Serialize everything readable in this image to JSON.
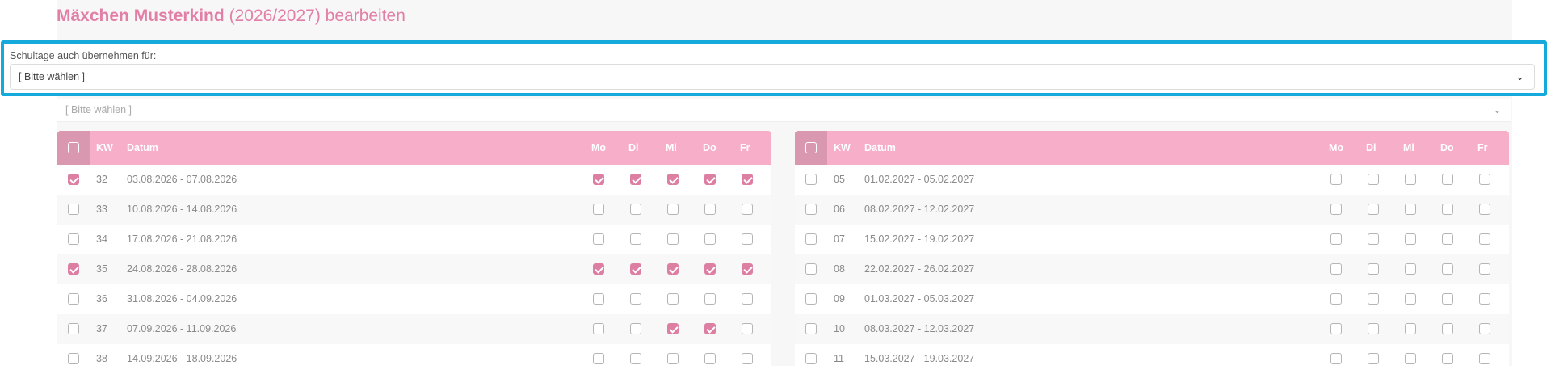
{
  "page": {
    "title_name": "Mäxchen Musterkind",
    "title_year": "(2026/2027)",
    "title_action": "bearbeiten"
  },
  "highlight_select": {
    "label": "Schultage auch übernehmen für:",
    "value": "[ Bitte wählen ]"
  },
  "ghost_select": {
    "value": "[ Bitte wählen ]"
  },
  "columns": {
    "kw": "KW",
    "datum": "Datum",
    "mo": "Mo",
    "di": "Di",
    "mi": "Mi",
    "do": "Do",
    "fr": "Fr"
  },
  "left_rows": [
    {
      "kw": "32",
      "date": "03.08.2026 - 07.08.2026",
      "sel": true,
      "days": [
        true,
        true,
        true,
        true,
        true
      ]
    },
    {
      "kw": "33",
      "date": "10.08.2026 - 14.08.2026",
      "sel": false,
      "days": [
        false,
        false,
        false,
        false,
        false
      ]
    },
    {
      "kw": "34",
      "date": "17.08.2026 - 21.08.2026",
      "sel": false,
      "days": [
        false,
        false,
        false,
        false,
        false
      ]
    },
    {
      "kw": "35",
      "date": "24.08.2026 - 28.08.2026",
      "sel": true,
      "days": [
        true,
        true,
        true,
        true,
        true
      ]
    },
    {
      "kw": "36",
      "date": "31.08.2026 - 04.09.2026",
      "sel": false,
      "days": [
        false,
        false,
        false,
        false,
        false
      ]
    },
    {
      "kw": "37",
      "date": "07.09.2026 - 11.09.2026",
      "sel": false,
      "days": [
        false,
        false,
        true,
        true,
        false
      ]
    },
    {
      "kw": "38",
      "date": "14.09.2026 - 18.09.2026",
      "sel": false,
      "days": [
        false,
        false,
        false,
        false,
        false
      ]
    }
  ],
  "right_rows": [
    {
      "kw": "05",
      "date": "01.02.2027 - 05.02.2027",
      "sel": false,
      "days": [
        false,
        false,
        false,
        false,
        false
      ]
    },
    {
      "kw": "06",
      "date": "08.02.2027 - 12.02.2027",
      "sel": false,
      "days": [
        false,
        false,
        false,
        false,
        false
      ]
    },
    {
      "kw": "07",
      "date": "15.02.2027 - 19.02.2027",
      "sel": false,
      "days": [
        false,
        false,
        false,
        false,
        false
      ]
    },
    {
      "kw": "08",
      "date": "22.02.2027 - 26.02.2027",
      "sel": false,
      "days": [
        false,
        false,
        false,
        false,
        false
      ]
    },
    {
      "kw": "09",
      "date": "01.03.2027 - 05.03.2027",
      "sel": false,
      "days": [
        false,
        false,
        false,
        false,
        false
      ]
    },
    {
      "kw": "10",
      "date": "08.03.2027 - 12.03.2027",
      "sel": false,
      "days": [
        false,
        false,
        false,
        false,
        false
      ]
    },
    {
      "kw": "11",
      "date": "15.03.2027 - 19.03.2027",
      "sel": false,
      "days": [
        false,
        false,
        false,
        false,
        false
      ]
    }
  ],
  "colors": {
    "accent": "#e27fa6",
    "header": "#f7aec8",
    "highlight_border": "#16a9dc",
    "checked": "#dd7fa3"
  },
  "icons": {
    "dropdown": "chevron-down-icon"
  }
}
